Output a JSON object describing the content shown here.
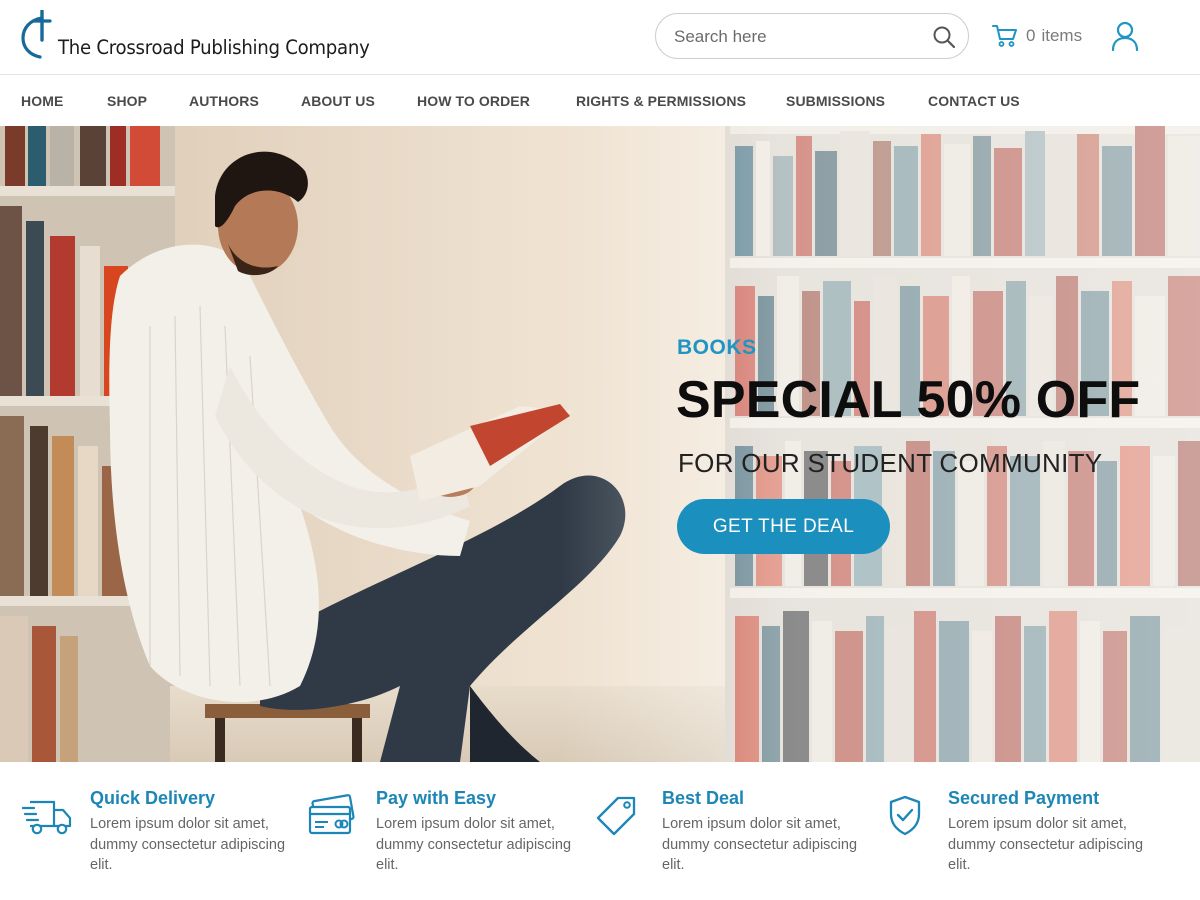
{
  "brand": {
    "name": "The Crossroad Publishing Company",
    "accent": "#1e95c3"
  },
  "search": {
    "placeholder": "Search here",
    "icon": "search-icon"
  },
  "cart": {
    "count": "0",
    "label": "items",
    "icon": "cart-icon"
  },
  "account": {
    "icon": "user-icon"
  },
  "nav": {
    "items": [
      {
        "label": "HOME"
      },
      {
        "label": "SHOP"
      },
      {
        "label": "AUTHORS"
      },
      {
        "label": "ABOUT US"
      },
      {
        "label": "HOW TO ORDER"
      },
      {
        "label": "RIGHTS & PERMISSIONS"
      },
      {
        "label": "SUBMISSIONS"
      },
      {
        "label": "CONTACT US"
      }
    ]
  },
  "hero": {
    "eyebrow": "BOOKS",
    "title": "SPECIAL 50% OFF",
    "subtitle": "FOR OUR STUDENT COMMUNITY",
    "cta": "GET THE DEAL",
    "cta_color": "#1b8fbd"
  },
  "features": [
    {
      "title": "Quick Delivery",
      "desc": "Lorem ipsum dolor sit amet, dummy consectetur adipiscing elit.",
      "icon": "delivery-truck-icon"
    },
    {
      "title": "Pay with Easy",
      "desc": "Lorem ipsum dolor sit amet, dummy consectetur adipiscing elit.",
      "icon": "credit-card-icon"
    },
    {
      "title": "Best Deal",
      "desc": "Lorem ipsum dolor sit amet, dummy consectetur adipiscing elit.",
      "icon": "price-tag-icon"
    },
    {
      "title": "Secured Payment",
      "desc": "Lorem ipsum dolor sit amet, dummy consectetur adipiscing elit.",
      "icon": "shield-check-icon"
    }
  ]
}
